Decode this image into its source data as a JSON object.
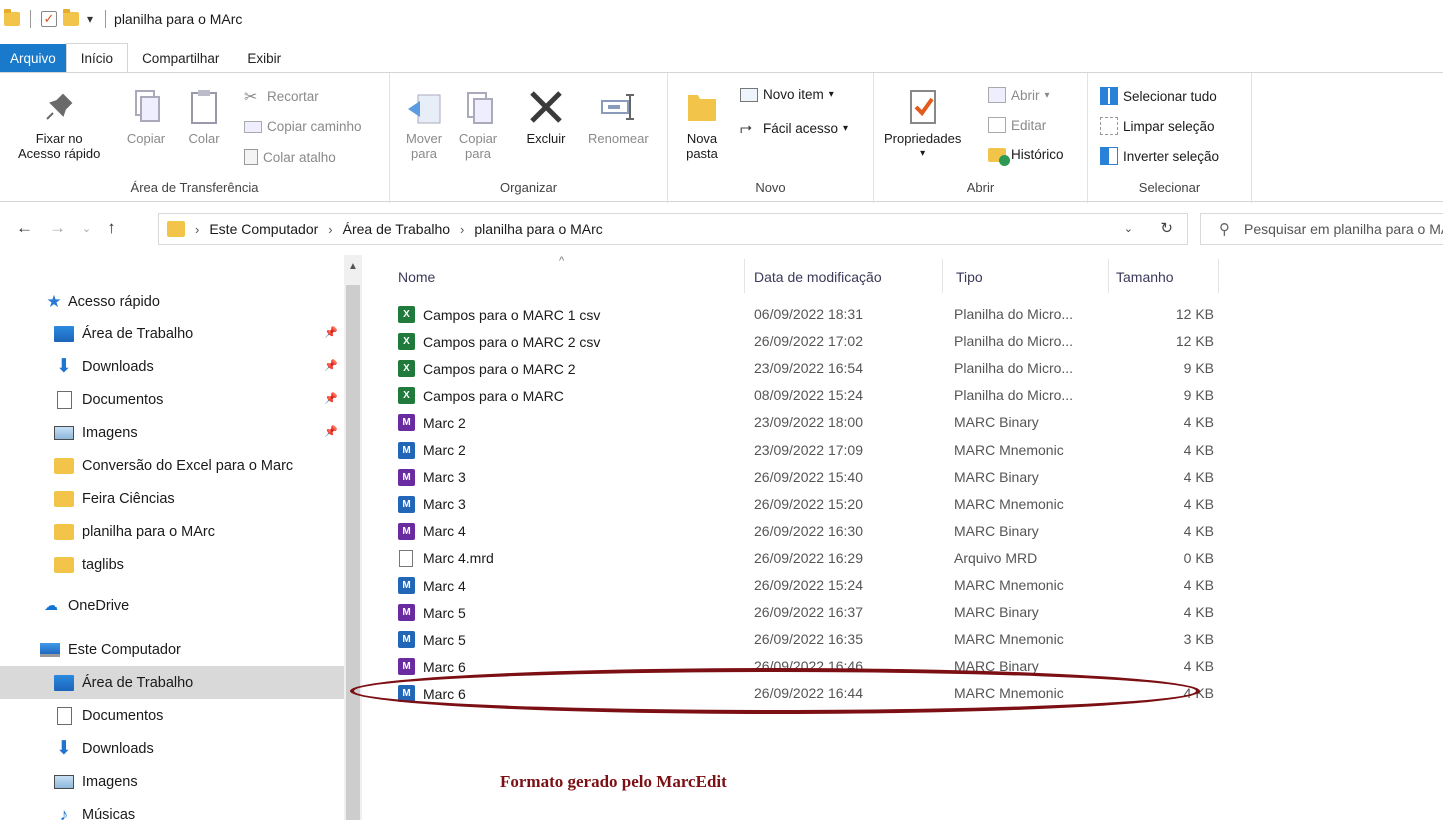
{
  "window": {
    "title": "planilha para o MArc"
  },
  "ribbon": {
    "tabs": [
      "Arquivo",
      "Início",
      "Compartilhar",
      "Exibir"
    ],
    "clipboard": {
      "label": "Área de Transferência",
      "pin_line1": "Fixar no",
      "pin_line2": "Acesso rápido",
      "copy": "Copiar",
      "paste": "Colar",
      "cut": "Recortar",
      "copy_path": "Copiar caminho",
      "paste_shortcut": "Colar atalho"
    },
    "organize": {
      "label": "Organizar",
      "move_line1": "Mover",
      "move_line2": "para",
      "copy_line1": "Copiar",
      "copy_line2": "para",
      "delete": "Excluir",
      "rename": "Renomear"
    },
    "new": {
      "label": "Novo",
      "new_folder_line1": "Nova",
      "new_folder_line2": "pasta",
      "new_item": "Novo item",
      "easy_access": "Fácil acesso"
    },
    "open": {
      "label": "Abrir",
      "properties": "Propriedades",
      "open": "Abrir",
      "edit": "Editar",
      "history": "Histórico"
    },
    "select": {
      "label": "Selecionar",
      "select_all": "Selecionar tudo",
      "select_none": "Limpar seleção",
      "invert": "Inverter seleção"
    }
  },
  "address": {
    "crumbs": [
      "Este Computador",
      "Área de Trabalho",
      "planilha para o MArc"
    ],
    "search_placeholder": "Pesquisar em planilha para o MArc"
  },
  "nav": {
    "quick_access": "Acesso rápido",
    "items": [
      {
        "label": "Área de Trabalho",
        "icon": "desktop-icon",
        "pinned": true
      },
      {
        "label": "Downloads",
        "icon": "download-icon",
        "pinned": true
      },
      {
        "label": "Documentos",
        "icon": "document-icon",
        "pinned": true
      },
      {
        "label": "Imagens",
        "icon": "image-icon",
        "pinned": true
      },
      {
        "label": "Conversão do Excel para o Marc",
        "icon": "folder-icon"
      },
      {
        "label": "Feira Ciências",
        "icon": "folder-icon"
      },
      {
        "label": "planilha para o MArc",
        "icon": "folder-icon"
      },
      {
        "label": "taglibs",
        "icon": "folder-icon"
      }
    ],
    "onedrive": "OneDrive",
    "this_pc": "Este Computador",
    "pc_items": [
      {
        "label": "Área de Trabalho",
        "icon": "desktop-icon",
        "selected": true
      },
      {
        "label": "Documentos",
        "icon": "document-icon"
      },
      {
        "label": "Downloads",
        "icon": "download-icon"
      },
      {
        "label": "Imagens",
        "icon": "image-icon"
      },
      {
        "label": "Músicas",
        "icon": "music-icon"
      }
    ]
  },
  "files": {
    "columns": [
      "Nome",
      "Data de modificação",
      "Tipo",
      "Tamanho"
    ],
    "rows": [
      {
        "name": "Campos para o MARC 1 csv",
        "date": "06/09/2022 18:31",
        "type": "Planilha do Micro...",
        "size": "12 KB",
        "icon": "excel-icon"
      },
      {
        "name": "Campos para o MARC 2 csv",
        "date": "26/09/2022 17:02",
        "type": "Planilha do Micro...",
        "size": "12 KB",
        "icon": "excel-icon"
      },
      {
        "name": "Campos para o MARC 2",
        "date": "23/09/2022 16:54",
        "type": "Planilha do Micro...",
        "size": "9 KB",
        "icon": "excel-icon"
      },
      {
        "name": "Campos para o MARC",
        "date": "08/09/2022 15:24",
        "type": "Planilha do Micro...",
        "size": "9 KB",
        "icon": "excel-icon"
      },
      {
        "name": "Marc 2",
        "date": "23/09/2022 18:00",
        "type": "MARC Binary",
        "size": "4 KB",
        "icon": "marc-binary-icon"
      },
      {
        "name": "Marc 2",
        "date": "23/09/2022 17:09",
        "type": "MARC Mnemonic",
        "size": "4 KB",
        "icon": "marc-mnemonic-icon"
      },
      {
        "name": "Marc 3",
        "date": "26/09/2022 15:40",
        "type": "MARC Binary",
        "size": "4 KB",
        "icon": "marc-binary-icon"
      },
      {
        "name": "Marc 3",
        "date": "26/09/2022 15:20",
        "type": "MARC Mnemonic",
        "size": "4 KB",
        "icon": "marc-mnemonic-icon"
      },
      {
        "name": "Marc 4",
        "date": "26/09/2022 16:30",
        "type": "MARC Binary",
        "size": "4 KB",
        "icon": "marc-binary-icon"
      },
      {
        "name": "Marc 4.mrd",
        "date": "26/09/2022 16:29",
        "type": "Arquivo MRD",
        "size": "0 KB",
        "icon": "blank-file-icon"
      },
      {
        "name": "Marc 4",
        "date": "26/09/2022 15:24",
        "type": "MARC Mnemonic",
        "size": "4 KB",
        "icon": "marc-mnemonic-icon"
      },
      {
        "name": "Marc 5",
        "date": "26/09/2022 16:37",
        "type": "MARC Binary",
        "size": "4 KB",
        "icon": "marc-binary-icon"
      },
      {
        "name": "Marc 5",
        "date": "26/09/2022 16:35",
        "type": "MARC Mnemonic",
        "size": "3 KB",
        "icon": "marc-mnemonic-icon"
      },
      {
        "name": "Marc 6",
        "date": "26/09/2022 16:46",
        "type": "MARC Binary",
        "size": "4 KB",
        "icon": "marc-binary-icon"
      },
      {
        "name": "Marc 6",
        "date": "26/09/2022 16:44",
        "type": "MARC Mnemonic",
        "size": "4 KB",
        "icon": "marc-mnemonic-icon"
      }
    ]
  },
  "annotation": {
    "caption": "Formato gerado pelo MarcEdit",
    "color": "#7b0f14"
  }
}
